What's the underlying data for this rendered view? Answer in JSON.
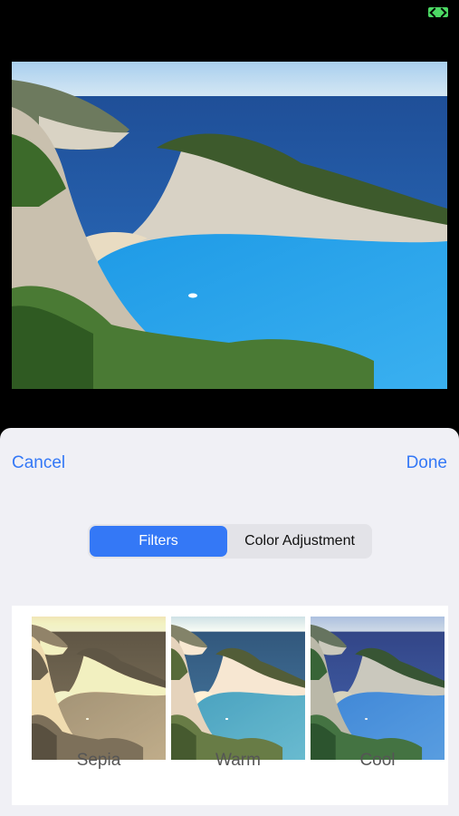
{
  "header": {
    "cancel_label": "Cancel",
    "done_label": "Done"
  },
  "segments": {
    "filters_label": "Filters",
    "color_adjustment_label": "Color Adjustment",
    "selected": "Filters"
  },
  "filters": [
    {
      "label": "Sepia"
    },
    {
      "label": "Warm"
    },
    {
      "label": "Cool"
    }
  ],
  "colors": {
    "accent": "#3478f6",
    "sheet_bg": "#f0f0f5",
    "segment_bg": "#e3e3e8",
    "status": "#4cd964"
  }
}
